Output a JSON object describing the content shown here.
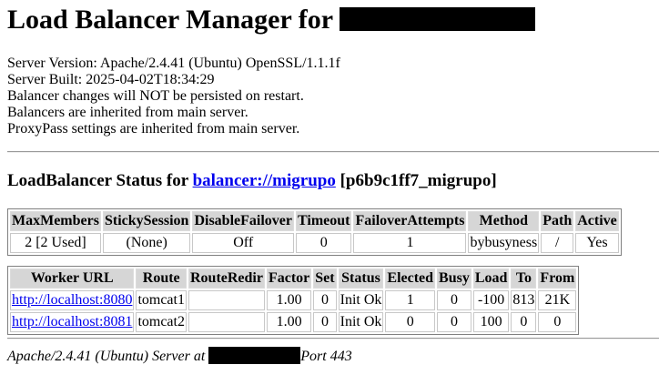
{
  "header": {
    "title": "Load Balancer Manager for",
    "redacted": true
  },
  "server_info": [
    "Server Version: Apache/2.4.41 (Ubuntu) OpenSSL/1.1.1f",
    "Server Built: 2025-04-02T18:34:29",
    "Balancer changes will NOT be persisted on restart.",
    "Balancers are inherited from main server.",
    "ProxyPass settings are inherited from main server."
  ],
  "balancer": {
    "status_prefix": "LoadBalancer Status for",
    "link": "balancer://migrupo",
    "id": "[p6b9c1ff7_migrupo]"
  },
  "balancer_table": {
    "headers": [
      "MaxMembers",
      "StickySession",
      "DisableFailover",
      "Timeout",
      "FailoverAttempts",
      "Method",
      "Path",
      "Active"
    ],
    "row": [
      "2 [2 Used]",
      "(None)",
      "Off",
      "0",
      "1",
      "bybusyness",
      "/",
      "Yes"
    ]
  },
  "workers_table": {
    "headers": [
      "Worker URL",
      "Route",
      "RouteRedir",
      "Factor",
      "Set",
      "Status",
      "Elected",
      "Busy",
      "Load",
      "To",
      "From"
    ],
    "rows": [
      [
        "http://localhost:8080",
        "tomcat1",
        "",
        "1.00",
        "0",
        "Init Ok",
        "1",
        "0",
        "-100",
        "813",
        "21K"
      ],
      [
        "http://localhost:8081",
        "tomcat2",
        "",
        "1.00",
        "0",
        "Init Ok",
        "0",
        "0",
        "100",
        "0",
        "0"
      ]
    ]
  },
  "footer": {
    "prefix": "Apache/2.4.41 (Ubuntu) Server at",
    "suffix": "Port 443"
  }
}
